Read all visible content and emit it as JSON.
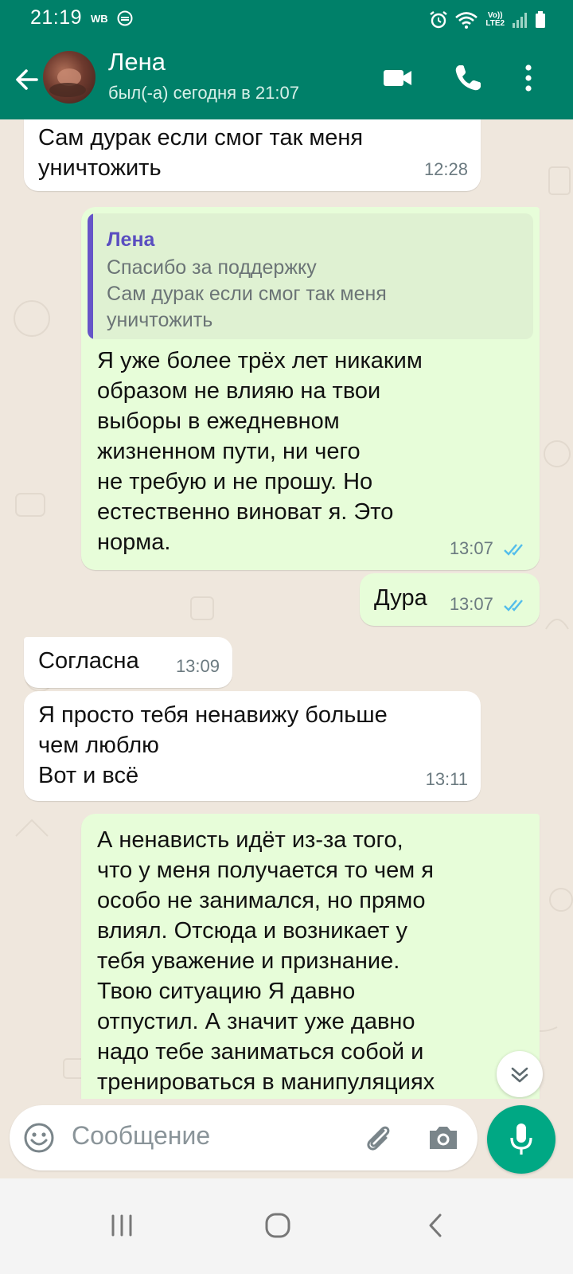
{
  "status_bar": {
    "time": "21:19",
    "carrier": "WB",
    "lte_top": "Vo))",
    "lte_bottom": "LTE2"
  },
  "header": {
    "contact_name": "Лена",
    "last_seen": "был(-а) сегодня в 21:07",
    "icons": [
      "back-arrow-icon",
      "video-call-icon",
      "voice-call-icon",
      "more-options-icon"
    ]
  },
  "messages": [
    {
      "direction": "in",
      "text": "Сам дурак если смог так меня\nуничтожить",
      "time": "12:28"
    },
    {
      "direction": "out",
      "quote": {
        "author": "Лена",
        "text": "Спасибо за поддержку\nСам дурак если смог так меня\nуничтожить"
      },
      "text": "Я уже более трёх лет никаким\nобразом не влияю на твои\nвыборы в ежедневном\nжизненном пути, ни чего\nне требую и не прошу. Но\nестественно виноват я. Это\nнорма.",
      "time": "13:07",
      "status": "read"
    },
    {
      "direction": "out",
      "text": "Дура",
      "time": "13:07",
      "status": "read"
    },
    {
      "direction": "in",
      "text": "Согласна",
      "time": "13:09"
    },
    {
      "direction": "in",
      "text": "Я просто тебя ненавижу больше\nчем люблю\nВот и всё",
      "time": "13:11"
    },
    {
      "direction": "out",
      "text": "А ненависть идёт из-за того,\nчто у меня получается то чем я\nособо не занимался, но прямо\nвлиял. Отсюда и возникает у\nтебя уважение и признание.\nТвою ситуацию Я давно\nотпустил. А значит уже давно\nнадо тебе заниматься собой и\nтренироваться в манипуляциях"
    }
  ],
  "input": {
    "placeholder": "Сообщение"
  },
  "colors": {
    "header_green": "#008069",
    "outgoing_bubble": "#e7fdd9",
    "incoming_bubble": "#ffffff",
    "read_ticks": "#53bdeb",
    "mic_button": "#00a884",
    "chat_background": "#efe7dd"
  }
}
